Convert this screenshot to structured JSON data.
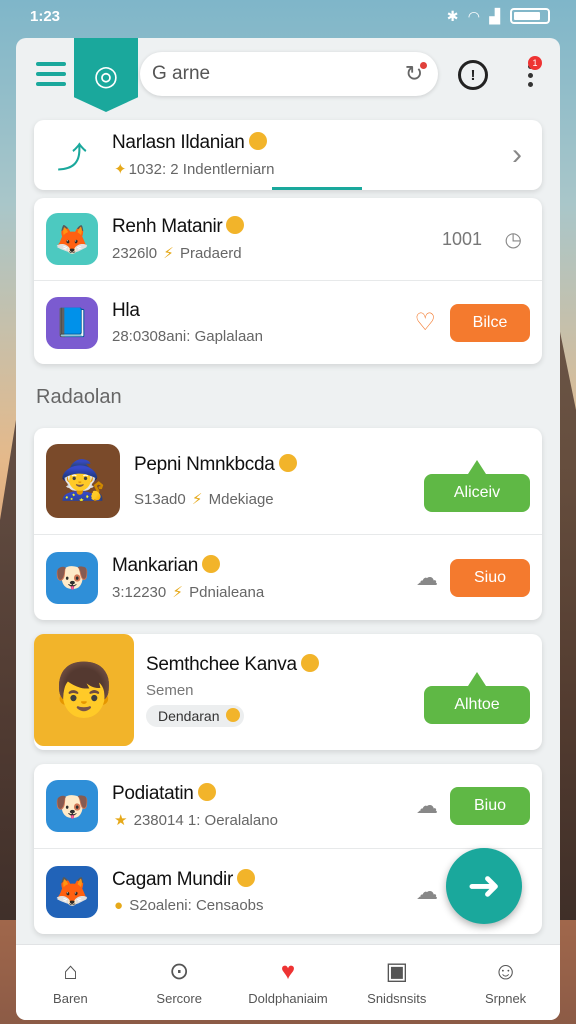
{
  "status": {
    "time": "1:23",
    "bluetooth_icon": "bluetooth-icon",
    "wifi_icon": "wifi-icon",
    "signal_icon": "signal-icon",
    "battery_icon": "battery-icon"
  },
  "header": {
    "search_value": "G arne",
    "search_icon": "refresh-icon",
    "logo_icon": "game-logo-icon",
    "notification_badge": "1"
  },
  "featured": {
    "title": "Narlasn Ildanian",
    "subtitle": "1032: 2 Indentlerniarn",
    "arrow": "›"
  },
  "list1": [
    {
      "title": "Renh Matanir",
      "subtitle_num": "2326l0",
      "subtitle_text": "Pradaerd",
      "right_value": "1001",
      "icon_bg": "#4cc9c0"
    },
    {
      "title": "Hla",
      "subtitle_num": "28:0308ani:",
      "subtitle_text": "Gaplalaan",
      "button": "Bilce",
      "icon_bg": "#7b5bd0"
    }
  ],
  "section_label": "Radaolan",
  "list2": [
    {
      "title": "Pepni Nmnkbcda",
      "subtitle_num": "S13ad0",
      "subtitle_text": "Mdekiage",
      "button": "Aliceiv",
      "icon_bg": "#7a4a2a"
    },
    {
      "title": "Mankarian",
      "subtitle_num": "3:12230",
      "subtitle_text": "Pdnialeana",
      "button": "Siuo",
      "icon_bg": "#2f8fd8"
    }
  ],
  "featured2": {
    "title": "Semthchee Kanva",
    "subtitle": "Semen",
    "tag": "Dendaran",
    "button": "Alhtoe",
    "icon_bg": "#f2b42a"
  },
  "list3": [
    {
      "title": "Podiatatin",
      "subtitle_num": "238014 1:",
      "subtitle_text": "Oeralalano",
      "button": "Biuo",
      "icon_bg": "#2f8fd8"
    },
    {
      "title": "Cagam Mundir",
      "subtitle_num": "S2oaleni:",
      "subtitle_text": "Censaobs",
      "icon_bg": "#2163b8"
    }
  ],
  "nav": [
    {
      "label": "Baren",
      "icon": "home-icon",
      "glyph": "⌂"
    },
    {
      "label": "Sercore",
      "icon": "search-icon",
      "glyph": "⊙"
    },
    {
      "label": "Doldphaniaim",
      "icon": "heart-icon",
      "glyph": "♥"
    },
    {
      "label": "Snidsnsits",
      "icon": "clipboard-icon",
      "glyph": "▣"
    },
    {
      "label": "Srpnek",
      "icon": "profile-icon",
      "glyph": "☺"
    }
  ],
  "colors": {
    "accent": "#1aa89c",
    "orange": "#f47a2e",
    "green": "#5fb845"
  }
}
